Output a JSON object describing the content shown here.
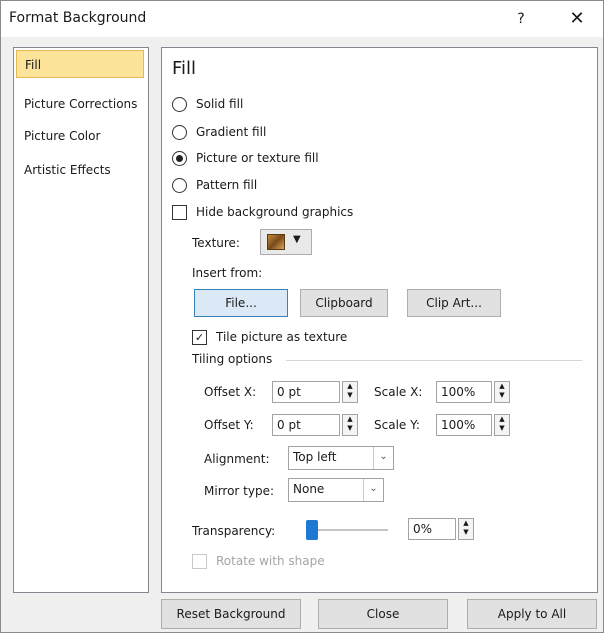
{
  "window": {
    "title": "Format Background",
    "help_label": "?",
    "close_label": "✕"
  },
  "sidebar": {
    "items": [
      {
        "label": "Fill",
        "selected": true
      },
      {
        "label": "Picture Corrections"
      },
      {
        "label": "Picture Color"
      },
      {
        "label": "Artistic Effects"
      }
    ]
  },
  "fill": {
    "heading": "Fill",
    "options": [
      {
        "label": "Solid fill",
        "checked": false
      },
      {
        "label": "Gradient fill",
        "checked": false
      },
      {
        "label": "Picture or texture fill",
        "checked": true
      },
      {
        "label": "Pattern fill",
        "checked": false
      }
    ],
    "hide_background": {
      "label": "Hide background graphics",
      "checked": false
    },
    "texture_label": "Texture:",
    "insert_from_label": "Insert from:",
    "buttons": {
      "file": "File...",
      "clipboard": "Clipboard",
      "clip_art": "Clip Art..."
    },
    "tile": {
      "label": "Tile picture as texture",
      "checked": true
    },
    "tiling_options_label": "Tiling options",
    "offset_x": {
      "label": "Offset X:",
      "value": "0 pt"
    },
    "offset_y": {
      "label": "Offset Y:",
      "value": "0 pt"
    },
    "scale_x": {
      "label": "Scale X:",
      "value": "100%"
    },
    "scale_y": {
      "label": "Scale Y:",
      "value": "100%"
    },
    "alignment": {
      "label": "Alignment:",
      "value": "Top left"
    },
    "mirror_type": {
      "label": "Mirror type:",
      "value": "None"
    },
    "transparency": {
      "label": "Transparency:",
      "value": "0%",
      "slider_percent": 0
    },
    "rotate_with_shape": {
      "label": "Rotate with shape",
      "checked": false,
      "enabled": false
    }
  },
  "footer": {
    "reset": "Reset Background",
    "close": "Close",
    "apply_all": "Apply to All"
  },
  "colors": {
    "selected_bg": "#fce39a",
    "focus_blue": "#3c7fb1",
    "slider_thumb": "#1f78d1"
  }
}
